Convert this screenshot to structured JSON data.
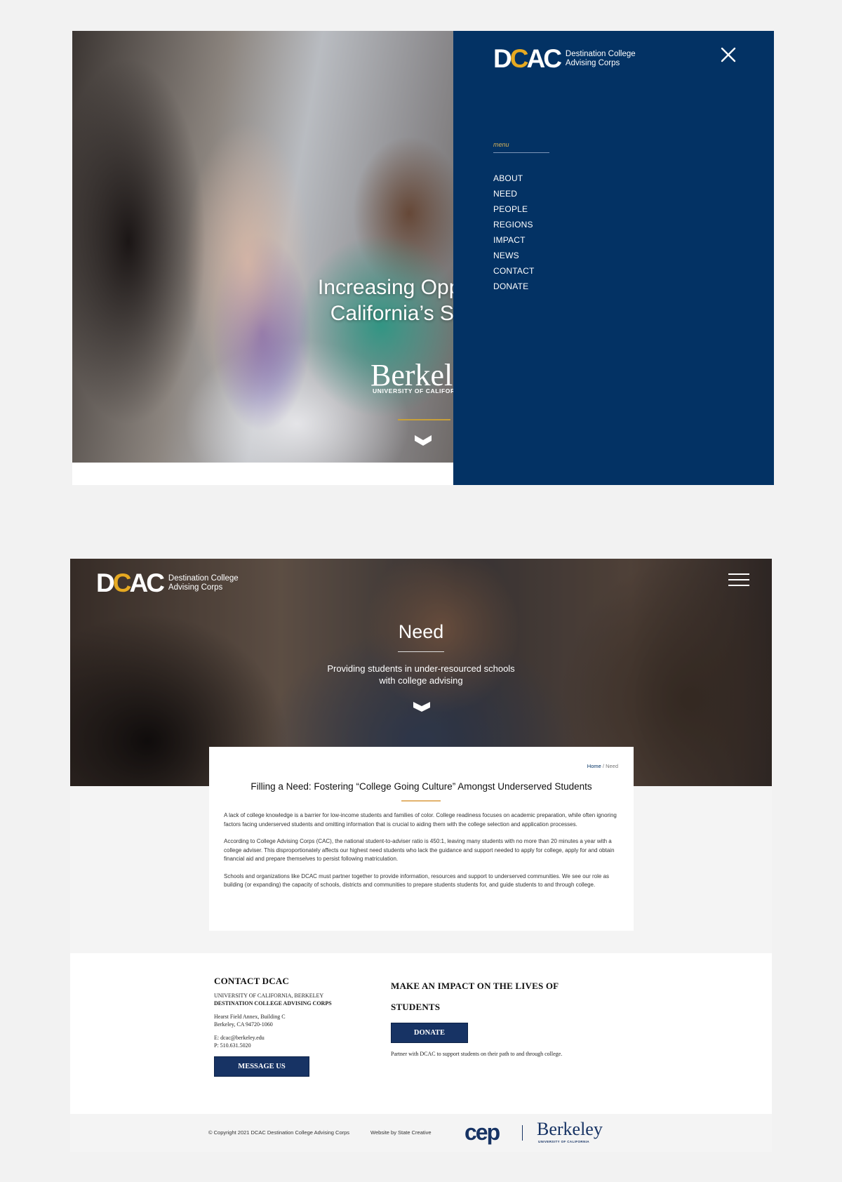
{
  "screen1": {
    "hero": {
      "title": "Increasing Oppo\nCalifornia’s St",
      "berkeley_wordmark": "Berkele",
      "berkeley_sub": "UNIVERSITY OF CALIFORNI"
    },
    "logo": {
      "mark_d": "D",
      "mark_c": "C",
      "mark_ac": "AC",
      "text_line1": "Destination College",
      "text_line2": "Advising Corps"
    },
    "menu": {
      "label": "menu",
      "items": [
        "ABOUT",
        "NEED",
        "PEOPLE",
        "REGIONS",
        "IMPACT",
        "NEWS",
        "CONTACT",
        "DONATE"
      ]
    },
    "icons": {
      "close": "close-icon",
      "scroll": "chevron-down-icon"
    }
  },
  "screen2": {
    "logo": {
      "mark_d": "D",
      "mark_c": "C",
      "mark_ac": "AC",
      "text_line1": "Destination College",
      "text_line2": "Advising Corps"
    },
    "hero": {
      "title": "Need",
      "subtitle": "Providing students in under-resourced schools\nwith college advising"
    },
    "breadcrumb": {
      "home": "Home",
      "separator": " / ",
      "current": "Need"
    },
    "article": {
      "title": "Filling a Need: Fostering “College Going Culture” Amongst Underserved Students",
      "paragraphs": [
        "A lack of college knowledge is a barrier for low-income students and families of color. College readiness focuses on academic preparation, while often ignoring factors facing underserved students and omitting information that is crucial to aiding them with the college selection and application processes.",
        "According to College Advising Corps (CAC), the national student-to-adviser ratio is 450:1, leaving many students with no more than 20 minutes a year with a college adviser. This disproportionately affects our highest need students who lack the guidance and support needed to apply for college, apply for and obtain financial aid and prepare themselves to persist following matriculation.",
        "Schools and organizations like DCAC must partner together to provide information, resources and support to underserved communities. We see our role as building (or expanding) the capacity of schools, districts and communities to prepare students students for, and guide students to and through college."
      ]
    },
    "footer": {
      "contact": {
        "heading": "CONTACT DCAC",
        "org_line1": "UNIVERSITY OF CALIFORNIA, BERKELEY",
        "org_line2": "DESTINATION COLLEGE ADVISING CORPS",
        "address_line1": "Hearst Field Annex, Building C",
        "address_line2": "Berkeley, CA 94720-1060",
        "email": "E: dcac@berkeley.edu",
        "phone": "P: 510.631.5020",
        "button": "MESSAGE US"
      },
      "impact": {
        "heading_line1": "MAKE AN IMPACT ON THE LIVES OF",
        "heading_line2": "STUDENTS",
        "button": "DONATE",
        "note": "Partner with DCAC to support students on their path to and through college."
      }
    },
    "bottom": {
      "copyright": "© Copyright 2021 DCAC Destination College Advising Corps",
      "credit": "Website by State Creative",
      "cep": "cep",
      "berkeley": "Berkeley",
      "berkeley_sub": "UNIVERSITY OF CALIFORNIA"
    }
  },
  "colors": {
    "navy": "#033264",
    "gold": "#e6a921",
    "button": "#173364"
  }
}
